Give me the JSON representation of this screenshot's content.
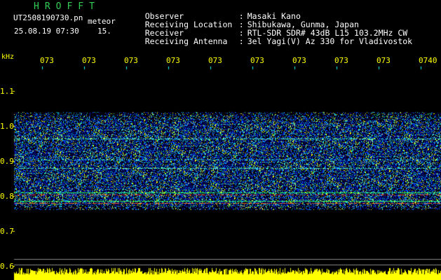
{
  "header": {
    "logo": "HROFFT",
    "filename": "UT2508190730.pn",
    "tag": "meteor",
    "date_time": "25.08.19 07:30",
    "count": "15."
  },
  "meta": [
    {
      "key": "Observer",
      "value": "Masaki Kano"
    },
    {
      "key": "Receiving Location",
      "value": "Shibukawa, Gunma, Japan"
    },
    {
      "key": "Receiver",
      "value": "RTL-SDR SDR# 43dB L15 103.2MHz CW"
    },
    {
      "key": "Receiving Antenna",
      "value": "3el Yagi(V) Az 330 for Vladivostok"
    }
  ],
  "axis": {
    "unit": "kHz",
    "x_ticks": [
      "073",
      "073",
      "073",
      "073",
      "073",
      "073",
      "073",
      "073",
      "073",
      "0740"
    ],
    "y_ticks": [
      "1.1",
      "1.0",
      "0.9",
      "0.8",
      "0.7",
      "0.6"
    ]
  },
  "colors": {
    "label_yellow": "#ffff00",
    "logo_green": "#33cc55",
    "tick_cyan": "#00ffff"
  }
}
